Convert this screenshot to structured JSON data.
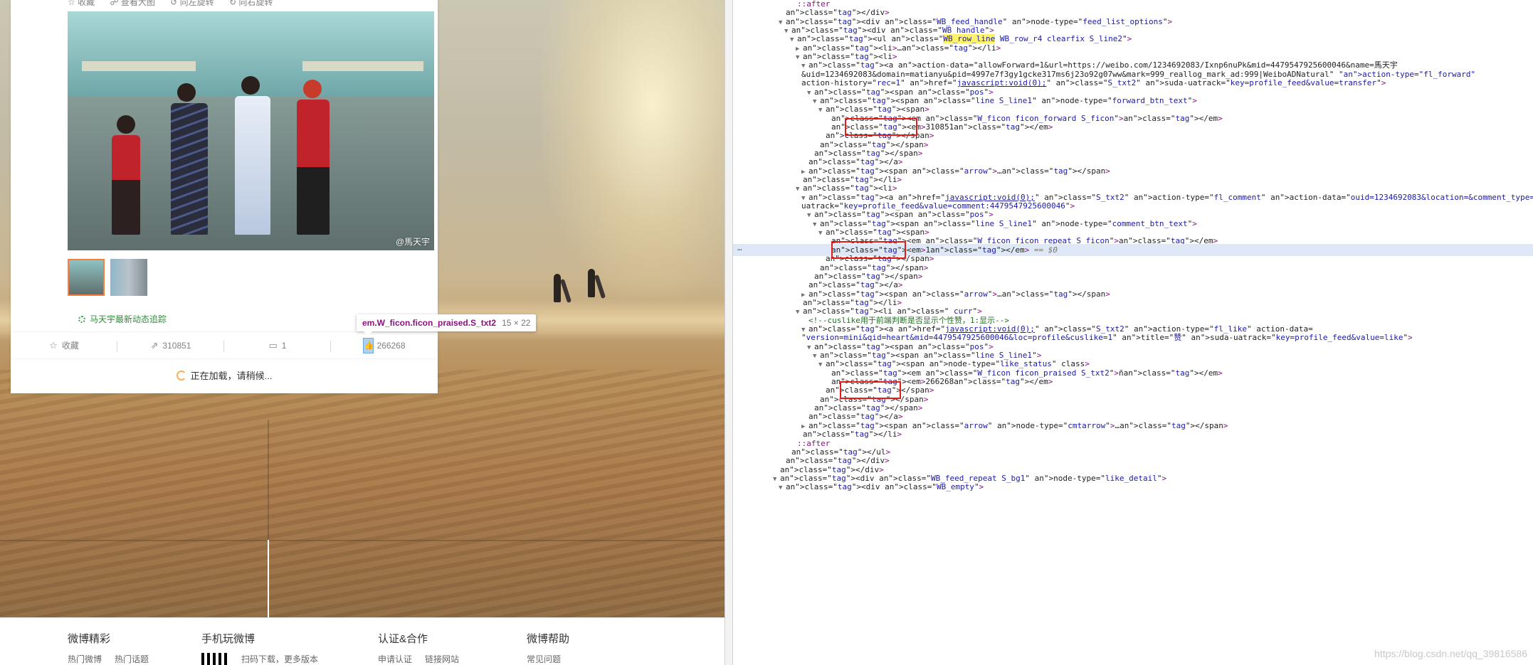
{
  "page": {
    "top_actions": [
      "☆ 收藏",
      "☍ 查看大图",
      "↺ 向左旋转",
      "↻ 向右旋转"
    ],
    "photo_watermark": "@馬天宇",
    "follow_text": "马天宇最新动态追踪",
    "handle": {
      "favorite": "收藏",
      "forward": "310851",
      "comment": "1",
      "like": "266268"
    },
    "loading": "正在加载，请稍候...",
    "footer": [
      {
        "title": "微博精彩",
        "links": [
          "热门微博",
          "热门话题"
        ]
      },
      {
        "title": "手机玩微博",
        "links": [
          "扫码下载，更多版本"
        ]
      },
      {
        "title": "认证&合作",
        "links": [
          "申请认证",
          "链接网站"
        ]
      },
      {
        "title": "微博帮助",
        "links": [
          "常见问题"
        ]
      }
    ]
  },
  "tooltip": {
    "selector": "em.W_ficon.ficon_praised.S_txt2",
    "size": "15 × 22"
  },
  "devtools": {
    "lines": [
      "::after",
      "</div>",
      "<div class=\"WB_feed_handle\" node-type=\"feed_list_options\">",
      "<div class=\"WB_handle\">",
      "<ul class=\"WB_row_line WB_row_r4 clearfix S_line2\">",
      "<li>…</li>",
      "<li>",
      "<a action-data=\"allowForward=1&url=https://weibo.com/1234692083/Ixnp6nuPk&mid=4479547925600046&name=馬天宇",
      "&uid=1234692083&domain=matianyu&pid=4997e7f3gy1gcke317ms6j23o92g07ww&mark=999_reallog_mark_ad:999|WeiboADNatural\" action-type=\"fl_forward\"",
      "action-history=\"rec=1\" href=\"javascript:void(0);\" class=\"S_txt2\" suda-uatrack=\"key=profile_feed&value=transfer\">",
      "<span class=\"pos\">",
      "<span class=\"line S_line1\" node-type=\"forward_btn_text\">",
      "<span>",
      "<em class=\"W_ficon ficon_forward S_ficon\">\u0000</em>",
      "<em>310851</em>",
      "</span>",
      "</span>",
      "</span>",
      "</a>",
      "<span class=\"arrow\">…</span>",
      "</li>",
      "<li>",
      "<a href=\"javascript:void(0);\" class=\"S_txt2\" action-type=\"fl_comment\" action-data=\"ouid=1234692083&location=&comment_type=0\" suda-",
      "uatrack=\"key=profile_feed&value=comment:4479547925600046\">",
      "<span class=\"pos\">",
      "<span class=\"line S_line1\" node-type=\"comment_btn_text\">",
      "<span>",
      "<em class=\"W_ficon ficon_repeat S_ficon\">\u0000</em>",
      "<em>1</em> == $0",
      "</span>",
      "</span>",
      "</span>",
      "</a>",
      "<span class=\"arrow\">…</span>",
      "</li>",
      "<li class=\" curr\">",
      "<!--cuslike用于前端判断是否显示个性赞，1:显示-->",
      "<a href=\"javascript:void(0);\" class=\"S_txt2\" action-type=\"fl_like\" action-data=",
      "\"version=mini&qid=heart&mid=4479547925600046&loc=profile&cuslike=1\" title=\"赞\" suda-uatrack=\"key=profile_feed&value=like\">",
      "<span class=\"pos\">",
      "<span class=\"line S_line1\">",
      "<span node-type=\"like_status\" class>",
      "<em class=\"W_ficon ficon_praised S_txt2\">ñ</em>",
      "<em>266268</em>",
      "</span>",
      "</span>",
      "</span>",
      "</a>",
      "<span class=\"arrow\" node-type=\"cmtarrow\">…</span>",
      "</li>",
      "::after",
      "</ul>",
      "</div>",
      "</div>",
      "<div class=\"WB_feed_repeat S_bg1\" node-type=\"like_detail\">",
      "<div class=\"WB_empty\">"
    ],
    "watermark": "https://blog.csdn.net/qq_39816586"
  }
}
